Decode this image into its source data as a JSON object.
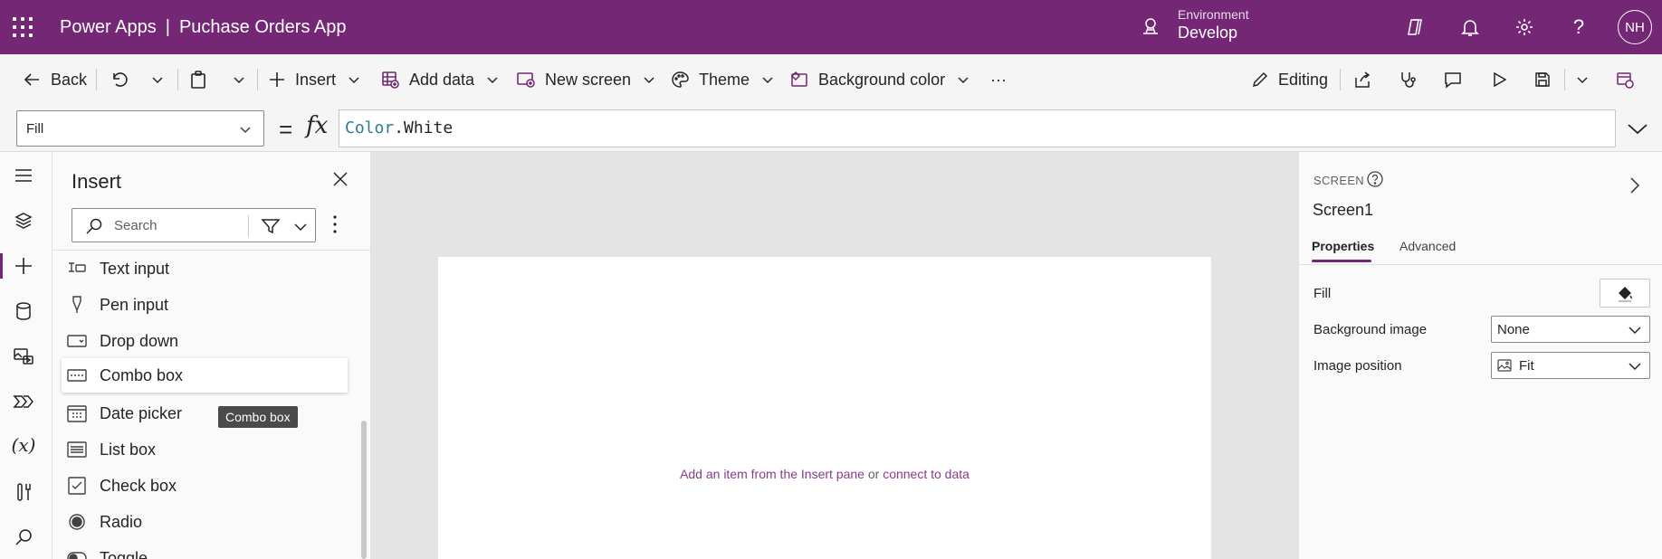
{
  "header": {
    "product": "Power Apps",
    "separator": "|",
    "app_name": "Puchase Orders App",
    "environment_label": "Environment",
    "environment_value": "Develop",
    "avatar_initials": "NH"
  },
  "toolbar": {
    "back": "Back",
    "insert": "Insert",
    "add_data": "Add data",
    "new_screen": "New screen",
    "theme": "Theme",
    "background_color": "Background color",
    "more": "···",
    "editing": "Editing"
  },
  "formula_bar": {
    "property": "Fill",
    "equals": "=",
    "fx": "fx",
    "formula_namespace": "Color",
    "formula_member": ".White"
  },
  "insert_pane": {
    "title": "Insert",
    "search_placeholder": "Search",
    "items": [
      {
        "label": "Text input",
        "icon": "text-input-icon"
      },
      {
        "label": "Pen input",
        "icon": "pen-icon"
      },
      {
        "label": "Drop down",
        "icon": "dropdown-icon"
      },
      {
        "label": "Combo box",
        "icon": "combo-box-icon"
      },
      {
        "label": "Date picker",
        "icon": "calendar-icon"
      },
      {
        "label": "List box",
        "icon": "list-box-icon"
      },
      {
        "label": "Check box",
        "icon": "checkbox-icon"
      },
      {
        "label": "Radio",
        "icon": "radio-icon"
      },
      {
        "label": "Toggle",
        "icon": "toggle-icon"
      }
    ],
    "tooltip": "Combo box"
  },
  "canvas": {
    "hint_link1": "Add an item from the Insert pane",
    "hint_or": "or",
    "hint_link2": "connect to data"
  },
  "properties_pane": {
    "caption": "SCREEN",
    "screen_name": "Screen1",
    "tabs": [
      "Properties",
      "Advanced"
    ],
    "fill_label": "Fill",
    "background_image_label": "Background image",
    "background_image_value": "None",
    "image_position_label": "Image position",
    "image_position_value": "Fit"
  },
  "colors": {
    "brand": "#742774",
    "link": "#8a3a8a"
  }
}
